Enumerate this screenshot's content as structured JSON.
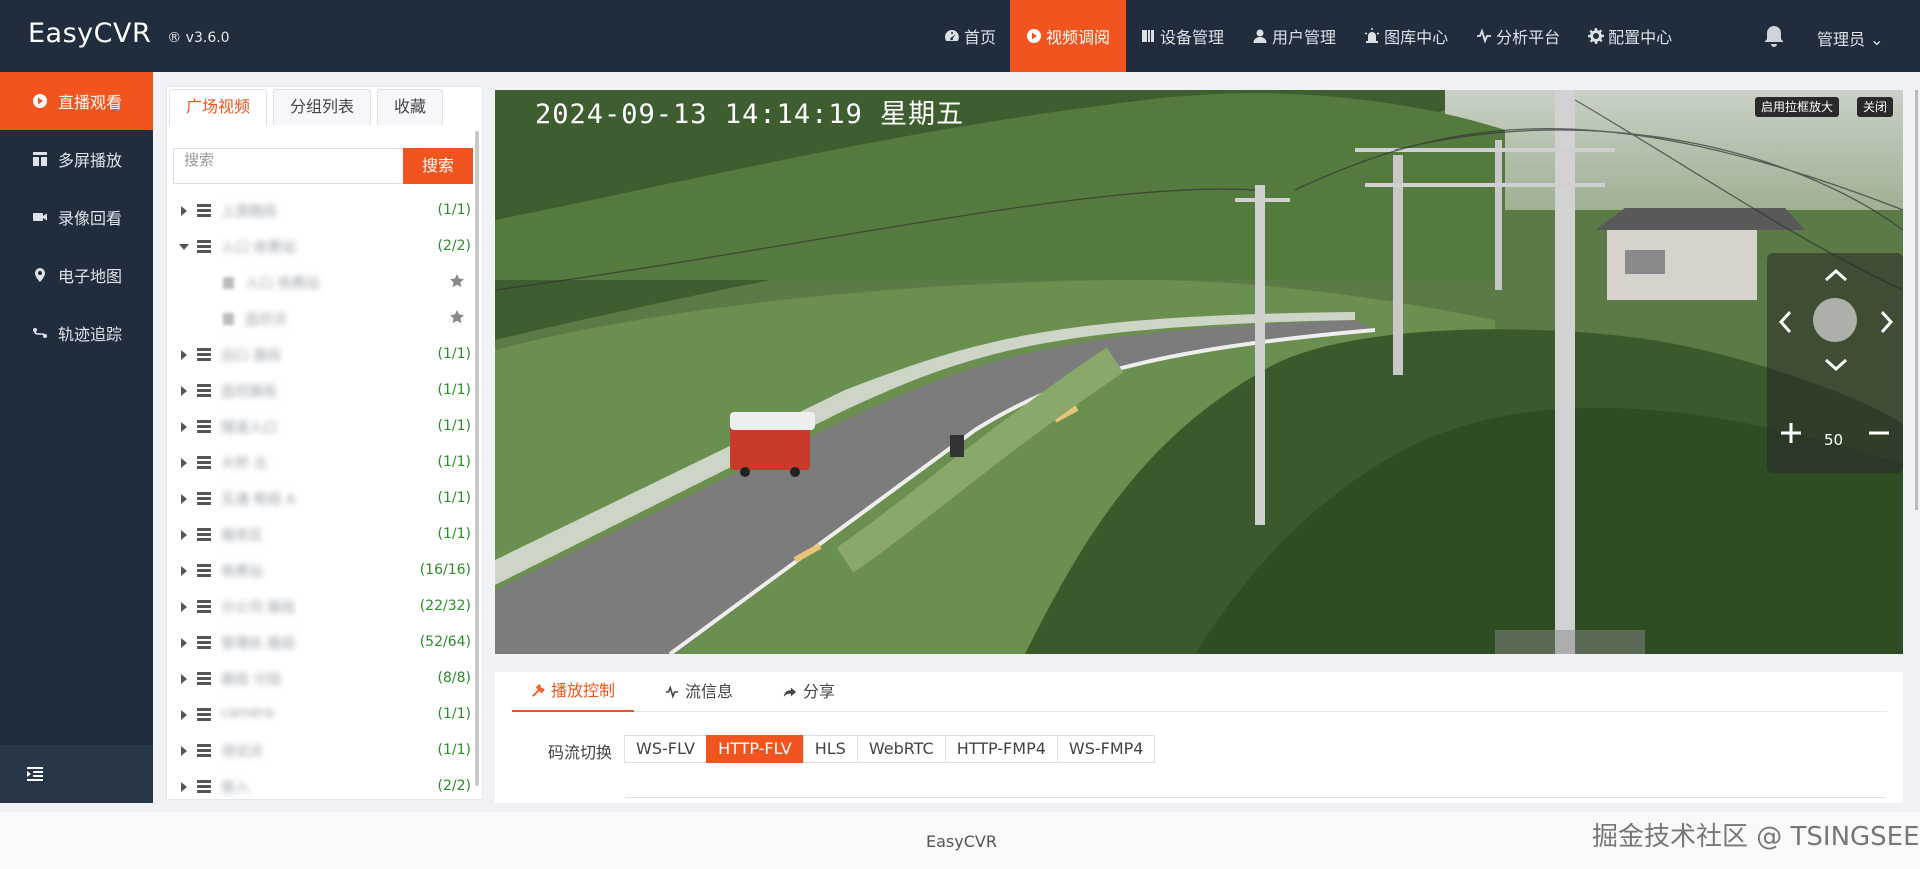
{
  "header": {
    "brand": "EasyCVR",
    "version": "® v3.6.0",
    "nav": [
      {
        "label": "首页",
        "icon": "dashboard-icon"
      },
      {
        "label": "视频调阅",
        "icon": "play-circle-icon",
        "active": true
      },
      {
        "label": "设备管理",
        "icon": "device-icon"
      },
      {
        "label": "用户管理",
        "icon": "user-icon"
      },
      {
        "label": "图库中心",
        "icon": "alarm-light-icon"
      },
      {
        "label": "分析平台",
        "icon": "pulse-icon"
      },
      {
        "label": "配置中心",
        "icon": "gear-icon"
      }
    ],
    "user": "管理员 ⌄"
  },
  "sidebar": {
    "items": [
      {
        "label": "直播观看",
        "icon": "play-circle-icon",
        "active": true
      },
      {
        "label": "多屏播放",
        "icon": "grid-icon"
      },
      {
        "label": "录像回看",
        "icon": "video-camera-icon"
      },
      {
        "label": "电子地图",
        "icon": "map-pin-icon"
      },
      {
        "label": "轨迹追踪",
        "icon": "track-icon"
      }
    ]
  },
  "tree_panel": {
    "tabs": [
      "广场视频",
      "分组列表",
      "收藏"
    ],
    "active_tab": 0,
    "search_placeholder": "搜索",
    "search_button": "搜索",
    "nodes": [
      {
        "label": "上游路段",
        "count": "(1/1)"
      },
      {
        "label": "入口 收费站",
        "count": "(2/2)",
        "expanded": true
      },
      {
        "label": "入口 收费站",
        "child": true
      },
      {
        "label": "监控点",
        "child": true
      },
      {
        "label": "出口 路段",
        "count": "(1/1)"
      },
      {
        "label": "监控路段",
        "count": "(1/1)"
      },
      {
        "label": "隧道入口",
        "count": "(1/1)"
      },
      {
        "label": "大桥 北",
        "count": "(1/1)"
      },
      {
        "label": "互通 枢纽 A",
        "count": "(1/1)"
      },
      {
        "label": "服务区",
        "count": "(1/1)"
      },
      {
        "label": "收费站",
        "count": "(16/16)"
      },
      {
        "label": "分公司 路段",
        "count": "(22/32)"
      },
      {
        "label": "管理处 路段",
        "count": "(52/64)"
      },
      {
        "label": "路段 分段",
        "count": "(8/8)"
      },
      {
        "label": "camera",
        "count": "(1/1)"
      },
      {
        "label": "测试点",
        "count": "(1/1)"
      },
      {
        "label": "接入",
        "count": "(2/2)"
      }
    ]
  },
  "video": {
    "osd_timestamp": "2024-09-13 14:14:19 星期五",
    "btn_zoom": "启用拉框放大",
    "btn_close": "关闭",
    "ptz_zoom": "50"
  },
  "controls": {
    "tabs": [
      {
        "label": "播放控制",
        "icon": "tools-icon",
        "active": true
      },
      {
        "label": "流信息",
        "icon": "pulse-icon"
      },
      {
        "label": "分享",
        "icon": "share-icon"
      }
    ],
    "stream_label": "码流切换",
    "streams": [
      "WS-FLV",
      "HTTP-FLV",
      "HLS",
      "WebRTC",
      "HTTP-FMP4",
      "WS-FMP4"
    ],
    "active_stream": 1
  },
  "footer": {
    "text": "EasyCVR"
  },
  "watermark": "掘金技术社区 @ TSINGSEE",
  "colors": {
    "accent": "#f2541f",
    "dark": "#1f2d3d",
    "count_green": "#2d8b2d"
  }
}
